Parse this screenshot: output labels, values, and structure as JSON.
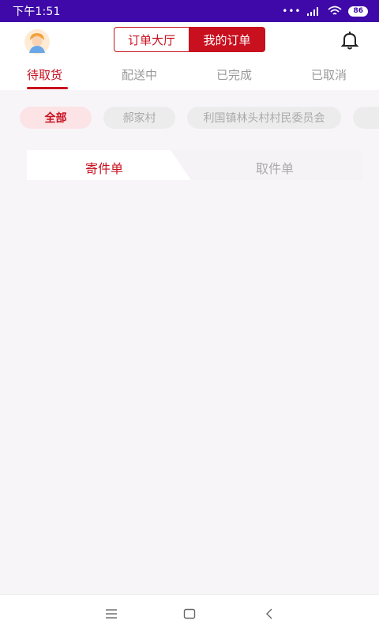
{
  "status_bar": {
    "time": "下午1:51",
    "dots": "•••",
    "battery": "86"
  },
  "header": {
    "segment": {
      "left_label": "订单大厅",
      "right_label": "我的订单"
    }
  },
  "tabs": [
    {
      "label": "待取货",
      "active": true
    },
    {
      "label": "配送中",
      "active": false
    },
    {
      "label": "已完成",
      "active": false
    },
    {
      "label": "已取消",
      "active": false
    }
  ],
  "filters": [
    {
      "label": "全部",
      "active": true
    },
    {
      "label": "郝家村",
      "active": false
    },
    {
      "label": "利国镇林头村村民委员会",
      "active": false
    }
  ],
  "subtabs": {
    "left": "寄件单",
    "right": "取件单",
    "active": "left"
  },
  "colors": {
    "status_bar": "#3e09a8",
    "accent": "#c8101f",
    "background": "#f7f5f8"
  },
  "icons": [
    "avatar-icon",
    "bell-icon",
    "menu-icon",
    "home-icon",
    "back-icon",
    "signal-icon",
    "wifi-icon"
  ]
}
